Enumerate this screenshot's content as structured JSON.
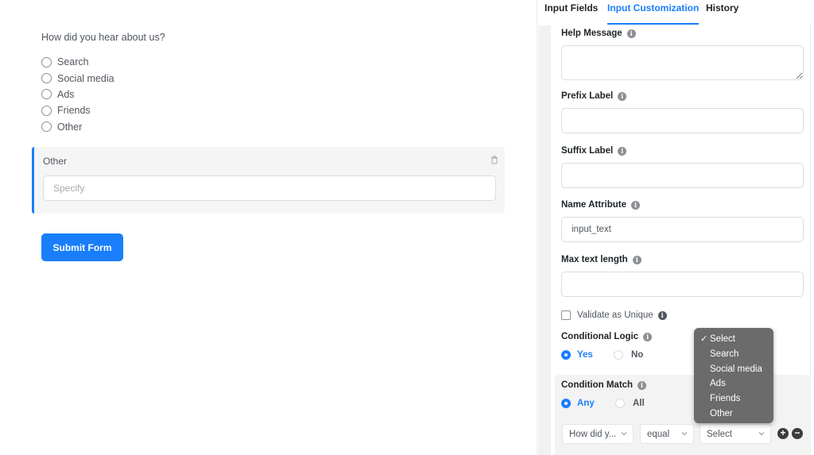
{
  "preview": {
    "question": "How did you hear about us?",
    "options": [
      "Search",
      "Social media",
      "Ads",
      "Friends",
      "Other"
    ],
    "other_block": {
      "label": "Other",
      "placeholder": "Specify",
      "delete_icon": "trash-icon"
    },
    "submit_label": "Submit Form"
  },
  "panel": {
    "tabs": [
      {
        "label": "Input Fields",
        "active": false
      },
      {
        "label": "Input Customization",
        "active": true
      },
      {
        "label": "History",
        "active": false
      }
    ],
    "fields": {
      "help_message": {
        "label": "Help Message",
        "value": ""
      },
      "prefix_label": {
        "label": "Prefix Label",
        "value": ""
      },
      "suffix_label": {
        "label": "Suffix Label",
        "value": ""
      },
      "name_attribute": {
        "label": "Name Attribute",
        "value": "input_text"
      },
      "max_text_length": {
        "label": "Max text length",
        "value": ""
      }
    },
    "validate_unique": {
      "label": "Validate as Unique",
      "checked": false
    },
    "conditional_logic": {
      "label": "Conditional Logic",
      "options": [
        "Yes",
        "No"
      ],
      "selected": "Yes"
    },
    "condition_match": {
      "label": "Condition Match",
      "options": [
        "Any",
        "All"
      ],
      "selected": "Any"
    },
    "rule": {
      "field": "How did y...",
      "operator": "equal",
      "value": "Select",
      "add_icon": "plus-circle-icon",
      "remove_icon": "minus-circle-icon"
    },
    "value_dropdown": {
      "selected": "Select",
      "options": [
        "Select",
        "Search",
        "Social media",
        "Ads",
        "Friends",
        "Other"
      ]
    }
  },
  "colors": {
    "accent": "#1a7efb",
    "dropdown_bg": "#6b6b6b",
    "block_bg": "#f5f5f5"
  }
}
